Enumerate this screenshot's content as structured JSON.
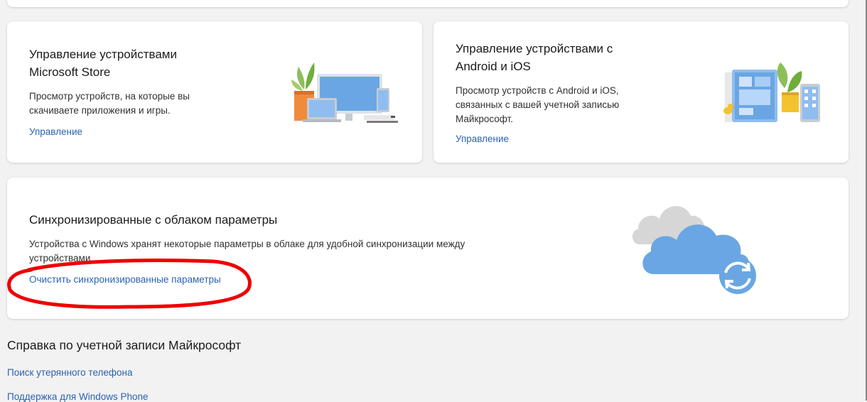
{
  "cards": {
    "store": {
      "title_line1": "Управление устройствами",
      "title_line2": "Microsoft Store",
      "desc_line1": "Просмотр устройств, на которые вы",
      "desc_line2": "скачиваете приложения и игры.",
      "link": "Управление"
    },
    "mobile": {
      "title_line1": "Управление устройствами с",
      "title_line2": "Android и iOS",
      "desc_line1": "Просмотр устройств с Android и iOS,",
      "desc_line2": "связанных с вашей учетной записью",
      "desc_line3": "Майкрософт.",
      "link": "Управление"
    },
    "sync": {
      "title": "Синхронизированные с облаком параметры",
      "desc_line1": "Устройства с Windows хранят некоторые параметры в облаке для удобной синхронизации между",
      "desc_line2": "устройствами.",
      "link": "Очистить синхронизированные параметры"
    }
  },
  "help": {
    "title": "Справка по учетной записи Майкрософт",
    "links": [
      "Поиск утерянного телефона",
      "Поддержка для Windows Phone"
    ]
  },
  "colors": {
    "link": "#2b63b1",
    "annotation": "#ee0000",
    "cloud_blue": "#6aa6e3",
    "cloud_gray": "#d6d6d6"
  }
}
